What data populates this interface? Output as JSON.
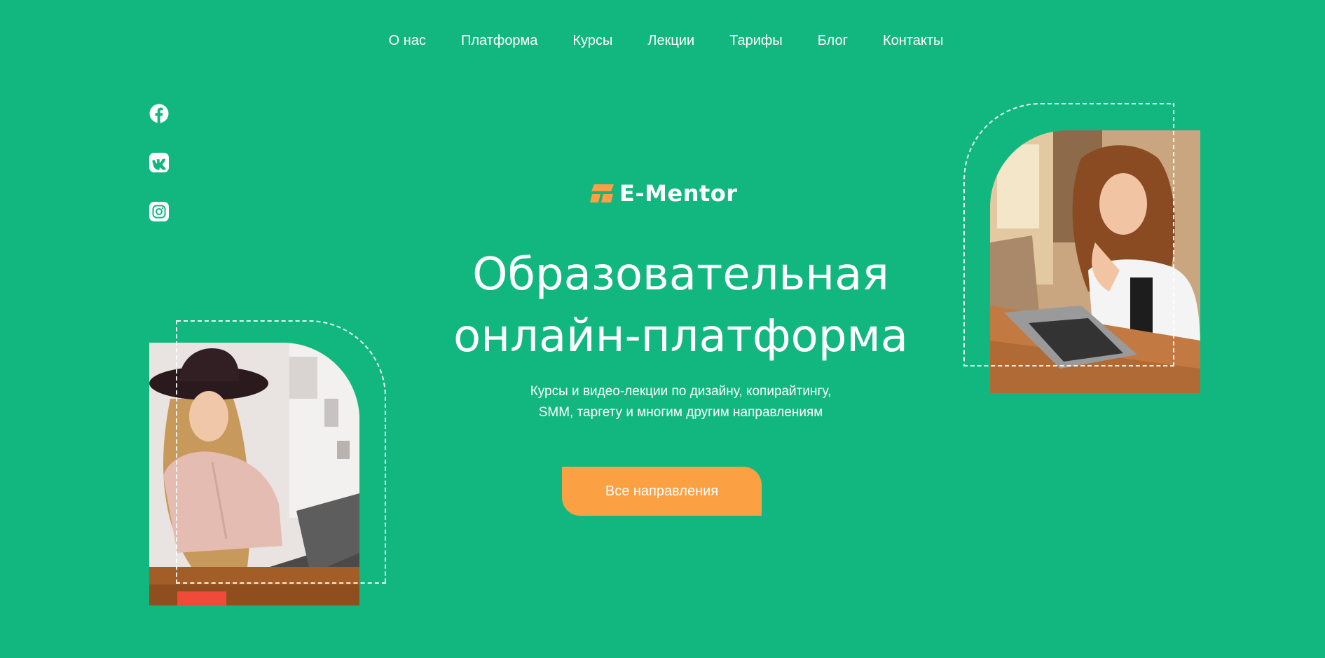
{
  "nav": {
    "items": [
      {
        "label": "О нас"
      },
      {
        "label": "Платформа"
      },
      {
        "label": "Курсы"
      },
      {
        "label": "Лекции"
      },
      {
        "label": "Тарифы"
      },
      {
        "label": "Блог"
      },
      {
        "label": "Контакты"
      }
    ]
  },
  "social": {
    "icons": [
      "facebook-icon",
      "vk-icon",
      "instagram-icon"
    ]
  },
  "logo": {
    "text": "E-Mentor",
    "mark_color": "#fba043"
  },
  "hero": {
    "headline_line1": "Образовательная",
    "headline_line2": "онлайн-платформа",
    "subtitle_line1": "Курсы и видео-лекции по дизайну, копирайтингу,",
    "subtitle_line2": "SMM, таргету и многим другим направлениям",
    "cta_label": "Все направления"
  },
  "colors": {
    "background": "#12b77f",
    "accent": "#fba043",
    "text": "#ffffff"
  }
}
